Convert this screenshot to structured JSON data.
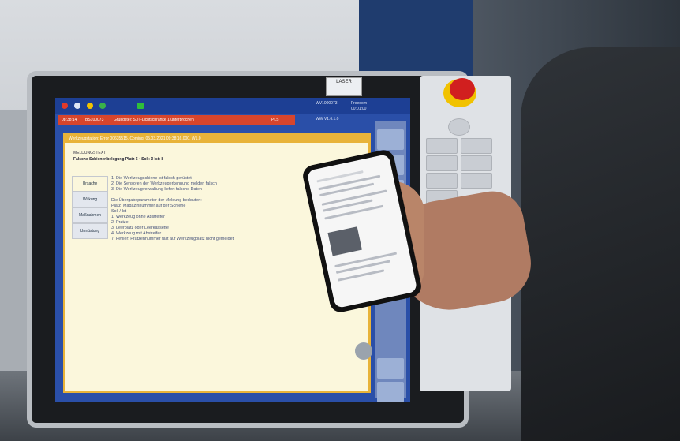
{
  "screen": {
    "error_bar": {
      "items": [
        "08:38:14",
        "BS100073",
        "Grundtitel: SDT-Lichtschranke 1 unterbrochen",
        "PLS"
      ]
    },
    "top_info": [
      "WV1000073",
      "Freedom",
      "00:01:00",
      "WW V1.6.1.0"
    ],
    "badge": "LASER",
    "dialog": {
      "title": "Werkzeugstation: Error 00635515, Coming, 05.03.2021 09:38:16.000, W1.0",
      "header": "MELDUNGSTEXT:",
      "subheader": "Falsche Schienenbelegung Platz 6 · Soll: 3 Ist: 8",
      "tabs": [
        "Ursache",
        "Wirkung",
        "Maßnahmen",
        "Umrüstung"
      ],
      "lines": [
        "1. Die Werkzeugschiene ist falsch gerüstet",
        "2. Die Sensoren der Werkzeugerkennung melden falsch",
        "3. Die Werkzeugverwaltung liefert falsche Daten",
        "",
        "Die Übergabeparameter der Meldung bedeuten:",
        "Platz: Magazinnummer auf der Schiene",
        "Soll / Ist",
        "1.  Werkzeug ohne Abstreifer",
        "2.  Pratze",
        "3.  Leerplatz oder Leerkassette",
        "4.  Werkzeug mit Abstreifer",
        "7.  Fehler: Pratzennummer fällt auf Werkzeugplatz nicht gemeldet"
      ]
    }
  },
  "colors": {
    "screen_blue": "#2a4fa8",
    "error_red": "#d7452c",
    "dialog_border": "#e8b339",
    "estop_red": "#d11f1f",
    "estop_yellow": "#f1c200"
  }
}
